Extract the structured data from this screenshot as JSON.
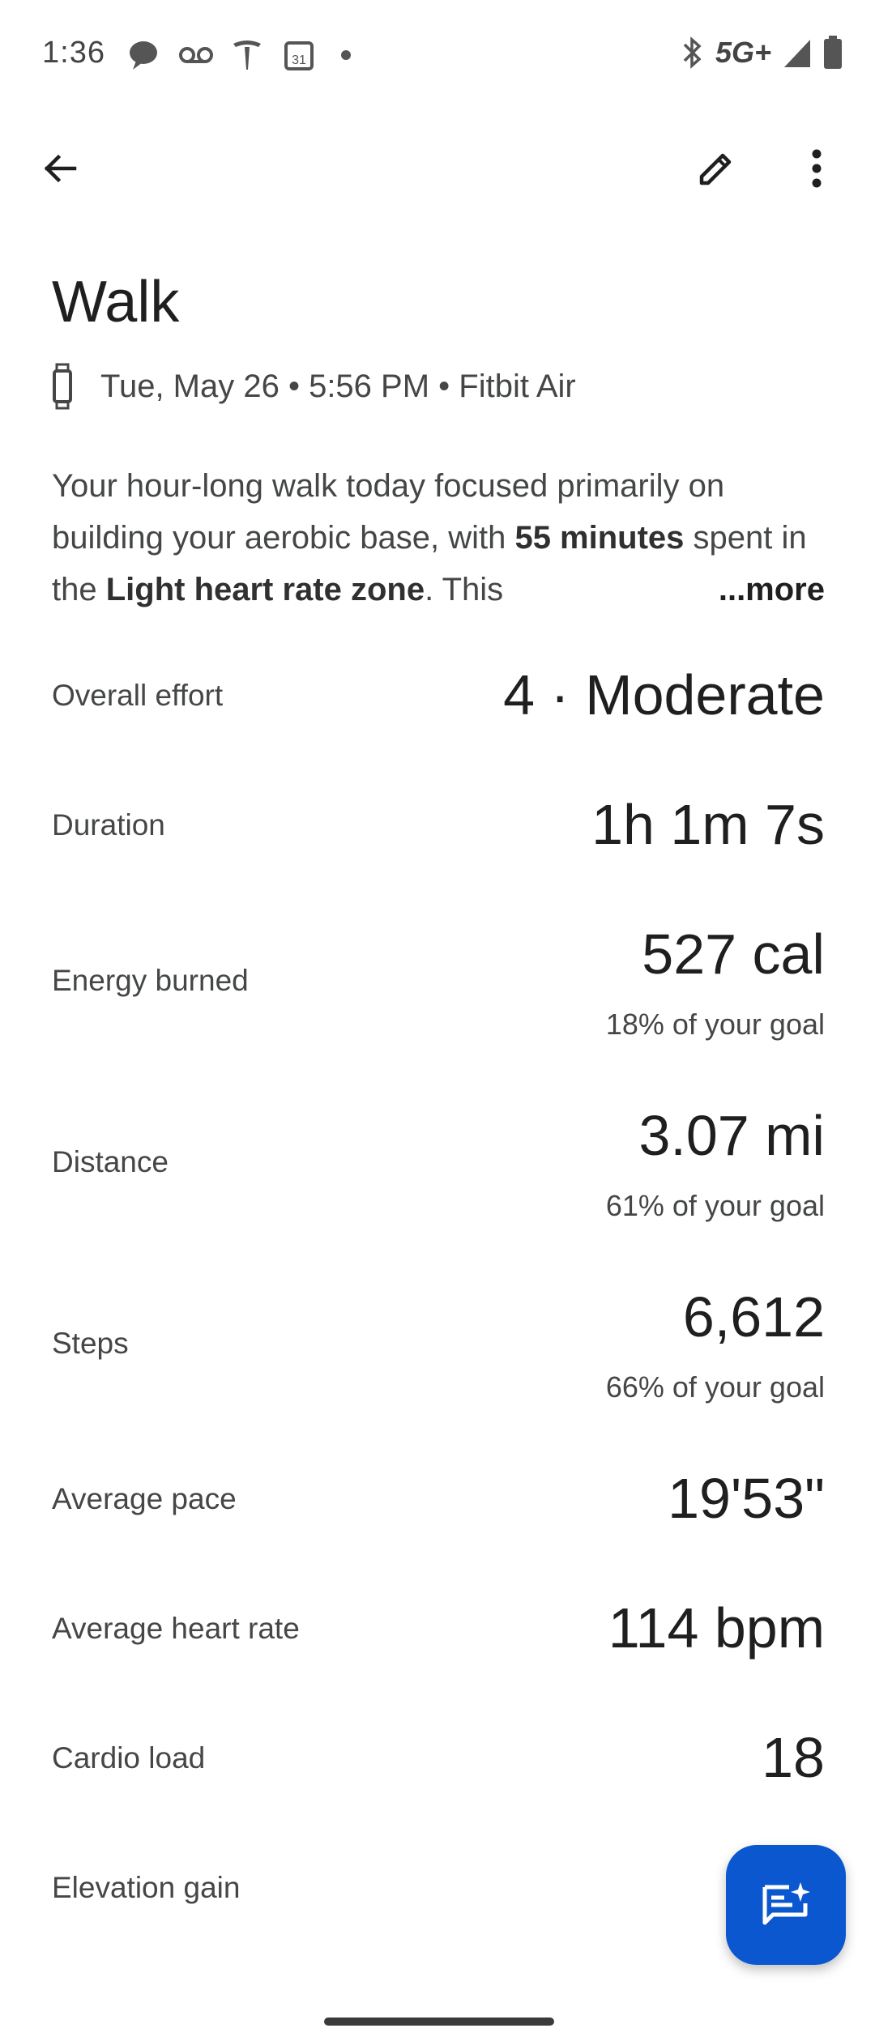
{
  "status_bar": {
    "time": "1:36",
    "left_icons": [
      "chat-bubble-icon",
      "voicemail-icon",
      "tesla-icon",
      "calendar-icon",
      "dot-icon"
    ],
    "calendar_day": "31",
    "network": "5G+",
    "right_icons": [
      "bluetooth-icon",
      "signal-icon",
      "battery-icon"
    ]
  },
  "app_bar": {
    "back_icon": "arrow-back-icon",
    "edit_icon": "pencil-icon",
    "more_icon": "more-vert-icon"
  },
  "workout": {
    "title": "Walk",
    "device_icon": "watch-icon",
    "meta": "Tue, May 26 • 5:56 PM • Fitbit Air",
    "summary_part1": "Your hour-long walk today focused primarily on building your aerobic base, with ",
    "summary_bold1": "55 minutes",
    "summary_part2": " spent in the ",
    "summary_bold2": "Light heart rate zone",
    "summary_part3": ". This",
    "more_label": "...more"
  },
  "stats": [
    {
      "label": "Overall effort",
      "value": "4 · Moderate",
      "sub": ""
    },
    {
      "label": "Duration",
      "value": "1h 1m 7s",
      "sub": ""
    },
    {
      "label": "Energy burned",
      "value": "527 cal",
      "sub": "18% of your goal"
    },
    {
      "label": "Distance",
      "value": "3.07 mi",
      "sub": "61% of your goal"
    },
    {
      "label": "Steps",
      "value": "6,612",
      "sub": "66% of your goal"
    },
    {
      "label": "Average pace",
      "value": "19'53\"",
      "sub": ""
    },
    {
      "label": "Average heart rate",
      "value": "114 bpm",
      "sub": ""
    },
    {
      "label": "Cardio load",
      "value": "18",
      "sub": ""
    },
    {
      "label": "Elevation gain",
      "value": "",
      "sub": ""
    }
  ],
  "fab": {
    "icon": "ai-chat-sparkle-icon"
  },
  "colors": {
    "accent": "#0b57d0",
    "text": "#1f1f1f",
    "secondary_text": "#444746"
  }
}
